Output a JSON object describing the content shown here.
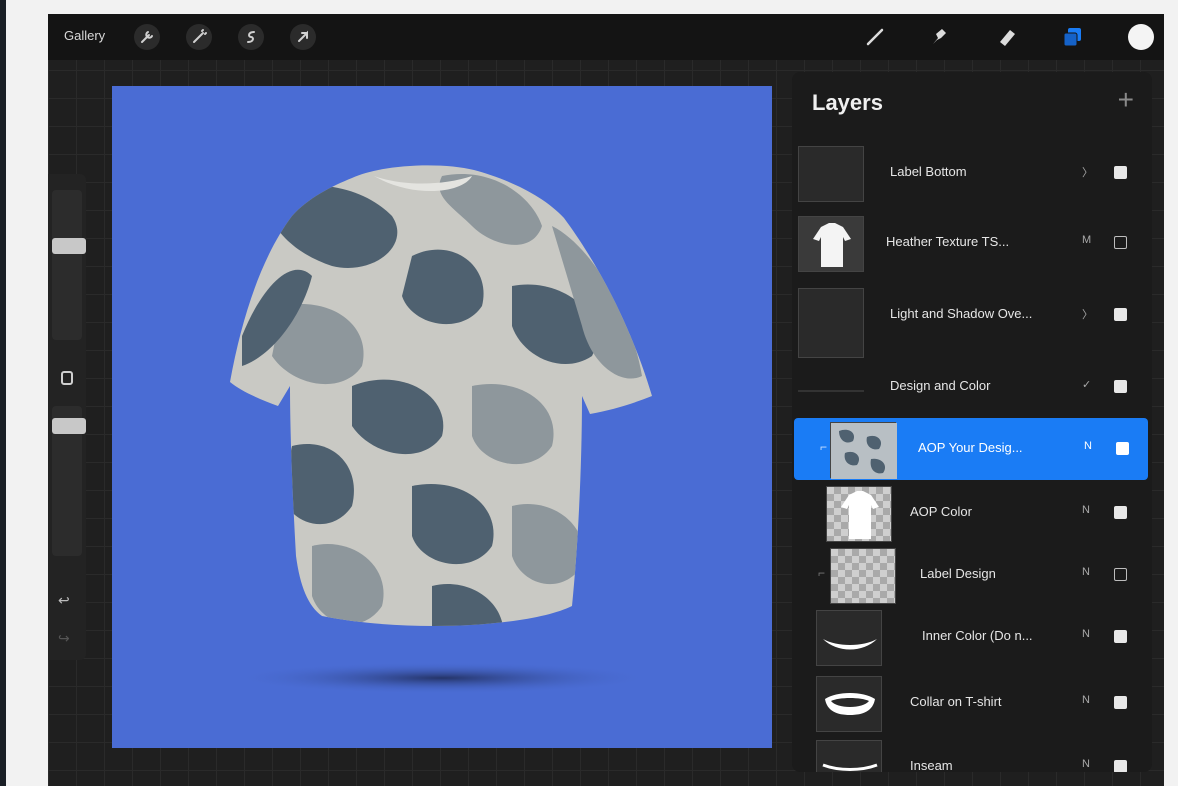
{
  "toolbar": {
    "gallery_label": "Gallery",
    "left_icons": [
      "wrench-icon",
      "magic-wand-icon",
      "selection-icon",
      "transform-icon"
    ],
    "right_icons": [
      "brush-icon",
      "smudge-icon",
      "eraser-icon",
      "layers-icon",
      "color-icon"
    ],
    "active_tool": "layers-icon",
    "current_color": "#f4f4f4"
  },
  "sidebar": {
    "brush_size": 0.33,
    "opacity": 0.1,
    "icons": [
      "modify-button-icon",
      "undo-icon",
      "redo-icon"
    ]
  },
  "canvas": {
    "background_color": "#4a6cd4",
    "subject": "camouflage t-shirt mockup"
  },
  "layers_panel": {
    "title": "Layers",
    "add_icon": "plus-icon",
    "layers": [
      {
        "name": "Label Bottom",
        "mode": "〉",
        "visible": true,
        "selected": false
      },
      {
        "name": "Heather Texture TS...",
        "mode": "M",
        "visible": false,
        "selected": false
      },
      {
        "name": "Light and Shadow Ove...",
        "mode": "〉",
        "visible": true,
        "selected": false
      },
      {
        "name": "Design and Color",
        "mode": "✓",
        "visible": true,
        "selected": false
      },
      {
        "name": "AOP Your Desig...",
        "mode": "N",
        "visible": true,
        "selected": true
      },
      {
        "name": "AOP Color",
        "mode": "N",
        "visible": true,
        "selected": false
      },
      {
        "name": "Label Design",
        "mode": "N",
        "visible": false,
        "selected": false
      },
      {
        "name": "Inner Color (Do n...",
        "mode": "N",
        "visible": true,
        "selected": false
      },
      {
        "name": "Collar on T-shirt",
        "mode": "N",
        "visible": true,
        "selected": false
      },
      {
        "name": "Inseam",
        "mode": "N",
        "visible": true,
        "selected": false
      }
    ]
  }
}
